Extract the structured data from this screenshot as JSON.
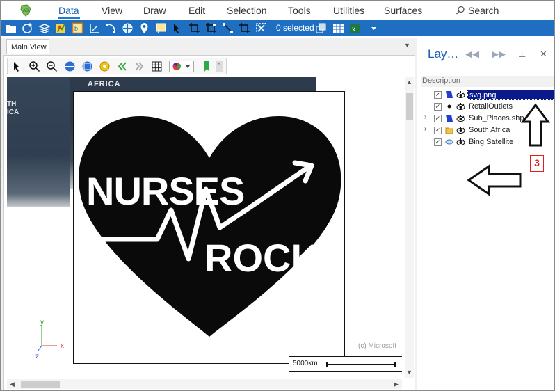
{
  "menu": {
    "items": [
      {
        "label": "Data",
        "active": true
      },
      {
        "label": "View"
      },
      {
        "label": "Draw"
      },
      {
        "label": "Edit"
      },
      {
        "label": "Selection"
      },
      {
        "label": "Tools"
      },
      {
        "label": "Utilities"
      },
      {
        "label": "Surfaces"
      }
    ],
    "search_label": "Search"
  },
  "toolbar": {
    "selected_text": "0 selected",
    "icons": [
      "open-folder-icon",
      "database-tool-icon",
      "layers-stack-icon",
      "map-icon",
      "select-box-icon",
      "measure-icon",
      "node-edit-icon",
      "globe-icon",
      "pin-icon",
      "frame-icon",
      "select-arrow-icon",
      "crop-icon",
      "vertex-icon",
      "vertex-add-icon",
      "crop-select-icon",
      "clear-selection-icon",
      "selection-export-icon",
      "table-icon",
      "excel-icon",
      "dropdown-icon"
    ]
  },
  "doc": {
    "tab_label": "Main View"
  },
  "map_toolbar": {
    "icons": [
      "pointer-icon",
      "zoom-in-icon",
      "zoom-out-icon",
      "globe-zoom-icon",
      "globe-extent-icon",
      "settings-gear-icon",
      "back-icon",
      "forward-icon",
      "grid-icon",
      "palette-icon",
      "bookmark-icon",
      "pin-toolbar-icon"
    ]
  },
  "map": {
    "place_label_top": "AFRICA",
    "place_label_left": "TH\nICA",
    "copyright": "(c) Microsoft",
    "scale_label": "5000km",
    "axis_labels": {
      "x": "x",
      "y": "y",
      "z": "z"
    },
    "image_text": {
      "line1": "NURSES",
      "line2": "ROCK"
    }
  },
  "layers": {
    "title": "Lay…",
    "description_header": "Description",
    "items": [
      {
        "name": "svg.png",
        "selected": true,
        "expandable": false,
        "icon": "image-layer-icon",
        "checked": true
      },
      {
        "name": "RetailOutlets",
        "selected": false,
        "expandable": false,
        "icon": "point-layer-icon",
        "checked": true
      },
      {
        "name": "Sub_Places.shp",
        "selected": false,
        "expandable": true,
        "icon": "polygon-layer-icon",
        "checked": true
      },
      {
        "name": "South Africa",
        "selected": false,
        "expandable": true,
        "icon": "folder-icon",
        "checked": true
      },
      {
        "name": "Bing Satellite",
        "selected": false,
        "expandable": false,
        "icon": "satellite-layer-icon",
        "checked": true
      }
    ]
  },
  "annotation": {
    "number": "3",
    "color": "#e02020"
  },
  "colors": {
    "toolbar_bg": "#1e6fc2",
    "accent": "#1a5fb4",
    "selected_row": "#0b1a8a"
  }
}
